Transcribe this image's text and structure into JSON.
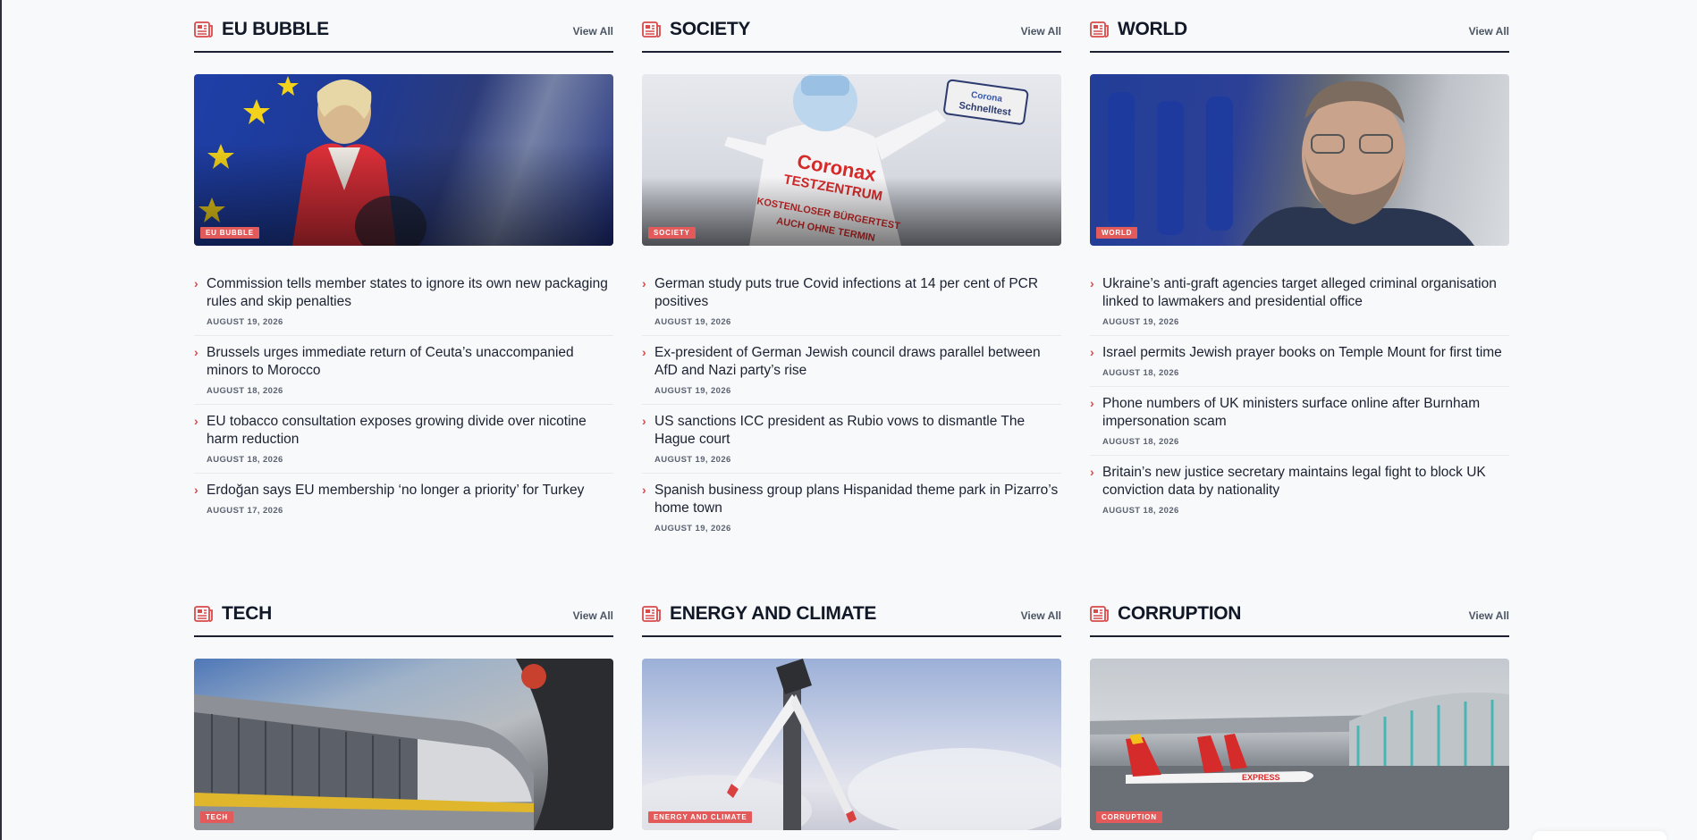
{
  "colors": {
    "accent": "#e25a5a",
    "text": "#1b2130",
    "background": "#f8f9fb"
  },
  "icon": "newspaper-icon",
  "sections": [
    {
      "title": "EU BUBBLE",
      "view_all": "View All",
      "tag": "EU BUBBLE",
      "articles": [
        {
          "headline": "Commission tells member states to ignore its own new packaging rules and skip penalties",
          "date": "AUGUST 19, 2026"
        },
        {
          "headline": "Brussels urges immediate return of Ceuta’s unaccompanied minors to Morocco",
          "date": "AUGUST 18, 2026"
        },
        {
          "headline": "EU tobacco consultation exposes growing divide over nicotine harm reduction",
          "date": "AUGUST 18, 2026"
        },
        {
          "headline": "Erdoğan says EU membership ‘no longer a priority’ for Turkey",
          "date": "AUGUST 17, 2026"
        }
      ]
    },
    {
      "title": "SOCIETY",
      "view_all": "View All",
      "tag": "SOCIETY",
      "articles": [
        {
          "headline": "German study puts true Covid infections at 14 per cent of PCR positives",
          "date": "AUGUST 19, 2026"
        },
        {
          "headline": "Ex-president of German Jewish council draws parallel between AfD and Nazi party’s rise",
          "date": "AUGUST 19, 2026"
        },
        {
          "headline": "US sanctions ICC president as Rubio vows to dismantle The Hague court",
          "date": "AUGUST 19, 2026"
        },
        {
          "headline": "Spanish business group plans Hispanidad theme park in Pizarro’s home town",
          "date": "AUGUST 19, 2026"
        }
      ]
    },
    {
      "title": "WORLD",
      "view_all": "View All",
      "tag": "WORLD",
      "articles": [
        {
          "headline": "Ukraine’s anti-graft agencies target alleged criminal organisation linked to lawmakers and presidential office",
          "date": "AUGUST 19, 2026"
        },
        {
          "headline": "Israel permits Jewish prayer books on Temple Mount for first time",
          "date": "AUGUST 18, 2026"
        },
        {
          "headline": "Phone numbers of UK ministers surface online after Burnham impersonation scam",
          "date": "AUGUST 18, 2026"
        },
        {
          "headline": "Britain’s new justice secretary maintains legal fight to block UK conviction data by nationality",
          "date": "AUGUST 18, 2026"
        }
      ]
    },
    {
      "title": "TECH",
      "view_all": "View All",
      "tag": "TECH",
      "articles": []
    },
    {
      "title": "ENERGY AND CLIMATE",
      "view_all": "View All",
      "tag": "ENERGY AND CLIMATE",
      "articles": []
    },
    {
      "title": "CORRUPTION",
      "view_all": "View All",
      "tag": "CORRUPTION",
      "articles": []
    }
  ],
  "balloon_text": {
    "sign": "Corona Schnelltest",
    "line1": "Coronax",
    "line2": "TESTZENTRUM",
    "line3": "KOSTENLOSER BÜRGERTEST",
    "line4": "AUCH OHNE TERMIN"
  },
  "airline_text": "EXPRESS"
}
